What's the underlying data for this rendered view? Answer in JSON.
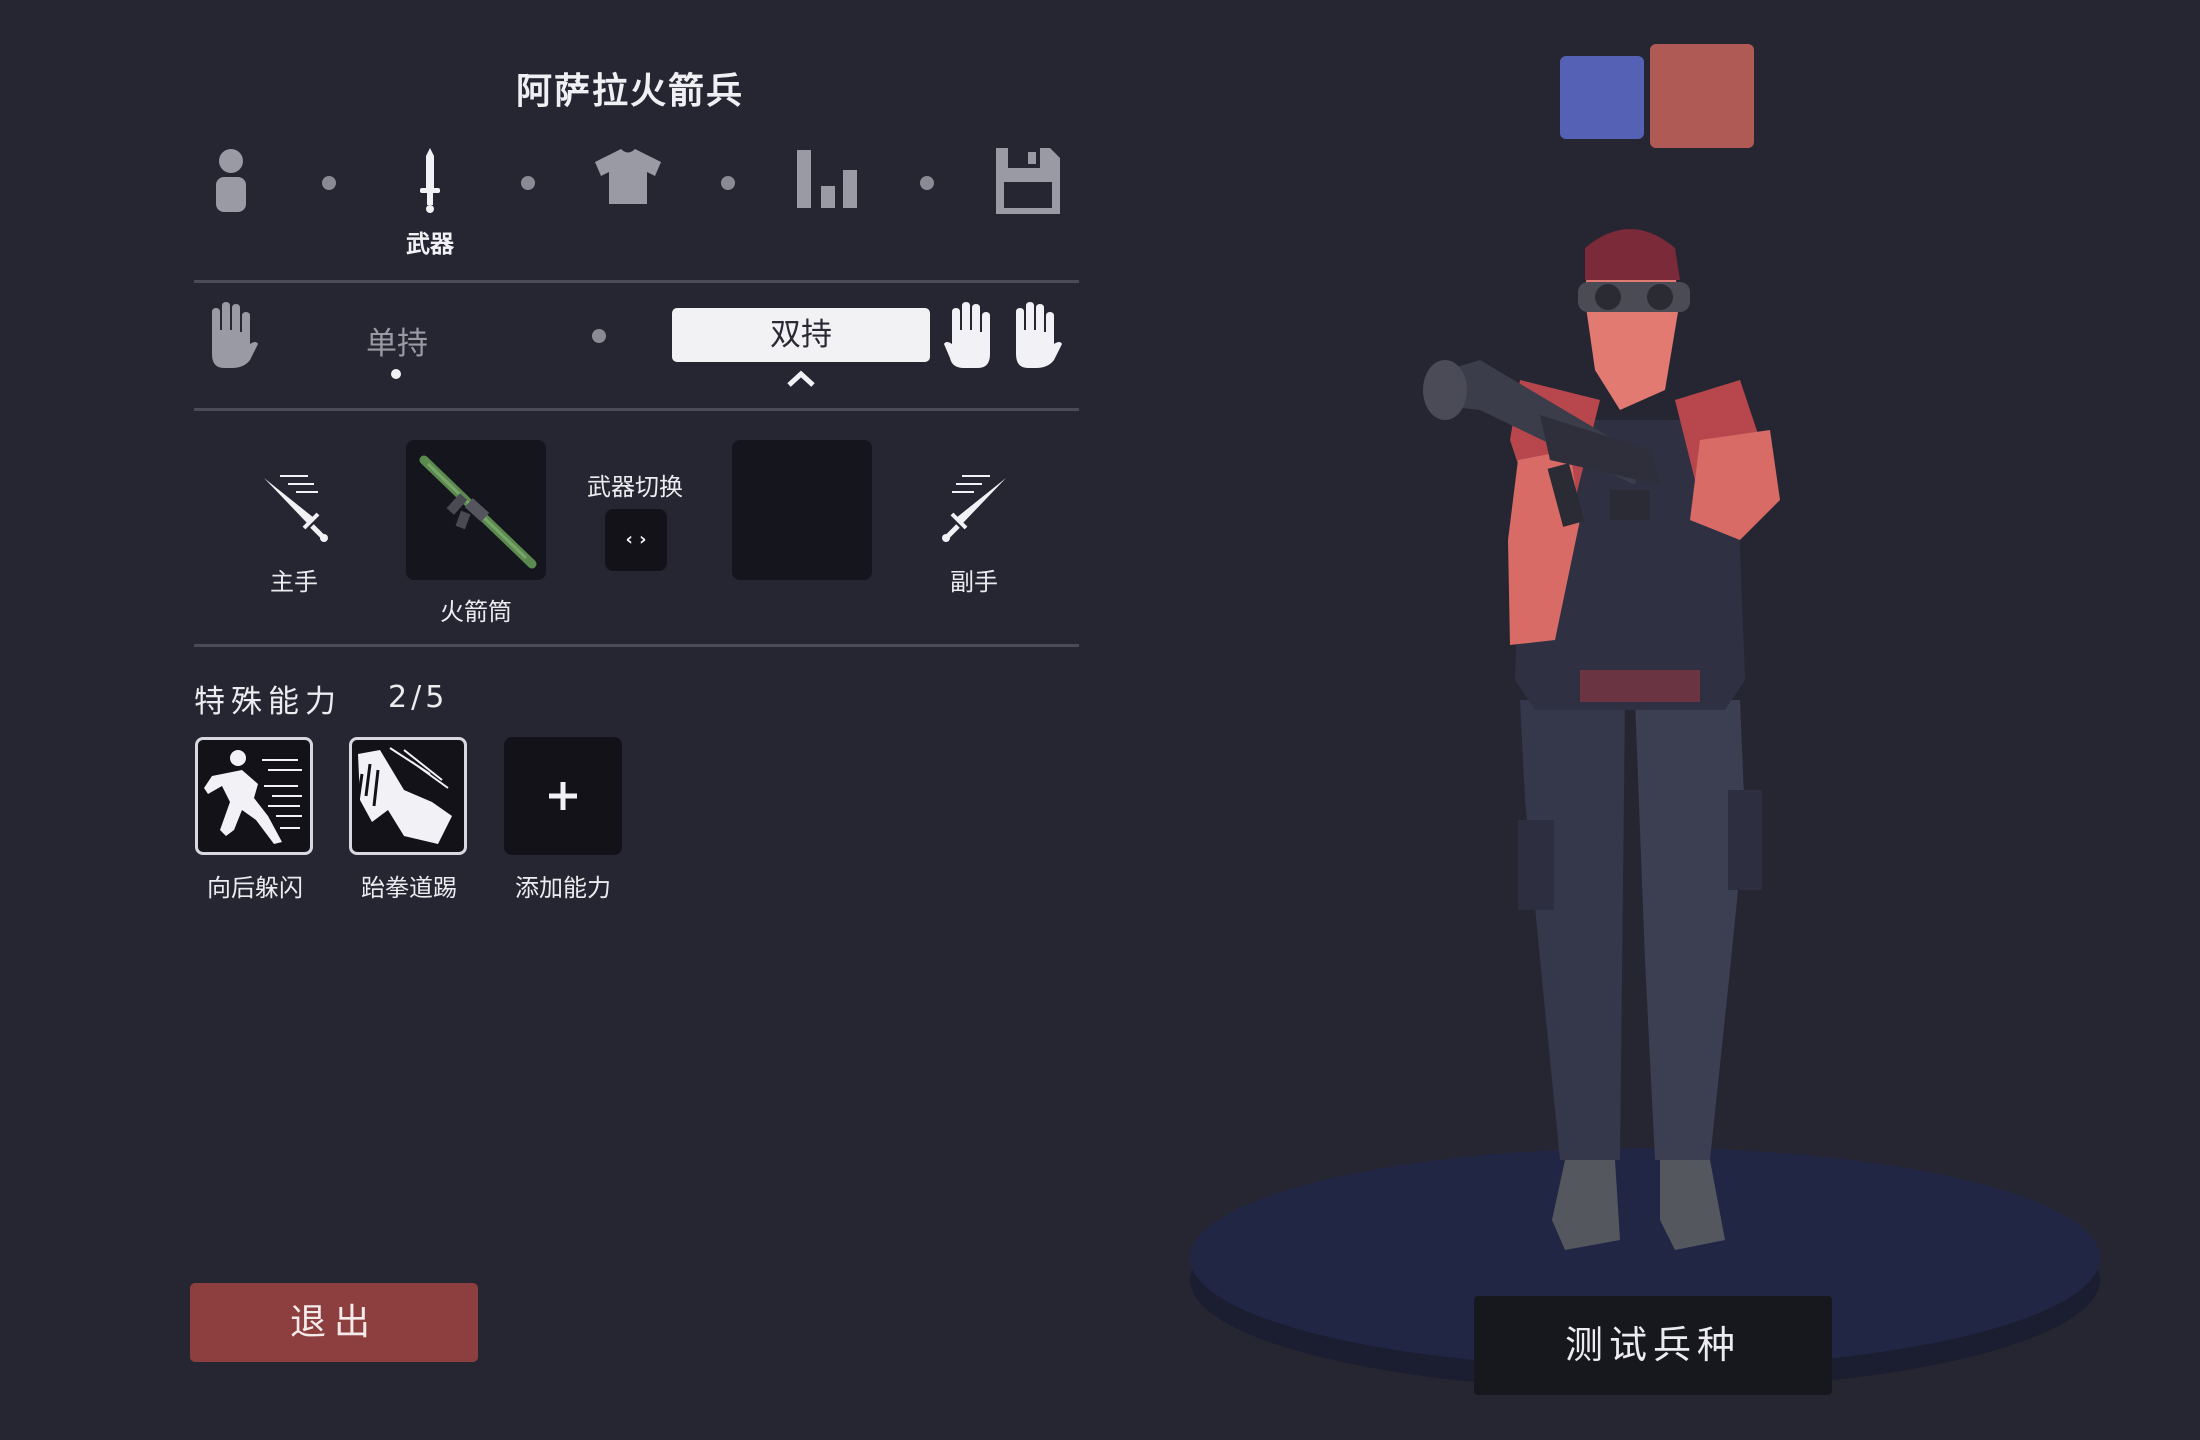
{
  "unit_name": "阿萨拉火箭兵",
  "category_tabs": [
    {
      "icon": "person-icon",
      "label": ""
    },
    {
      "icon": "sword-icon",
      "label": "武器"
    },
    {
      "icon": "shirt-icon",
      "label": ""
    },
    {
      "icon": "stats-icon",
      "label": ""
    },
    {
      "icon": "save-icon",
      "label": ""
    }
  ],
  "grip": {
    "single_label": "单持",
    "dual_label": "双持",
    "selected": "双持"
  },
  "weapons": {
    "main_hand_label": "主手",
    "main_weapon_name": "火箭筒",
    "swap_label": "武器切换",
    "swap_icon": "‹ ›",
    "off_hand_label": "副手"
  },
  "abilities": {
    "header": "特殊能力",
    "count": "2/5",
    "items": [
      {
        "name": "向后躲闪",
        "icon": "dodge-back-icon"
      },
      {
        "name": "跆拳道踢",
        "icon": "taekwondo-kick-icon"
      },
      {
        "name": "添加能力",
        "icon": "plus-icon"
      }
    ]
  },
  "team_colors": {
    "blue": "#5461b5",
    "red": "#b05a55"
  },
  "exit_label": "退出",
  "test_label": "测试兵种"
}
